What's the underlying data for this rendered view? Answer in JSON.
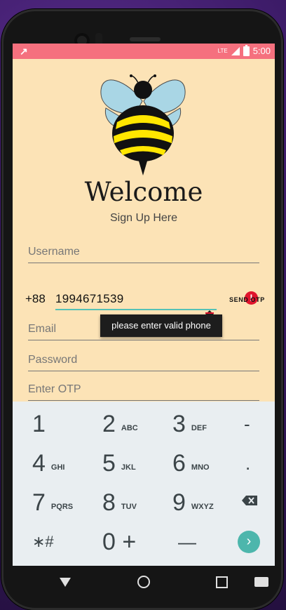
{
  "status_bar": {
    "time": "5:00",
    "network": "LTE",
    "left_icon": "notification-icon",
    "color": "#f5707e"
  },
  "header": {
    "logo": "bee-logo",
    "title": "Welcome",
    "subtitle": "Sign Up Here"
  },
  "form": {
    "username_placeholder": "Username",
    "country_code": "+88",
    "phone_value": "1994671539",
    "send_otp_label": "SEND OTP",
    "phone_error": "please enter valid phone",
    "email_placeholder": "Email",
    "password_placeholder": "Password",
    "otp_placeholder": "Enter OTP"
  },
  "keyboard": {
    "keys": [
      {
        "main": "1",
        "sub": ""
      },
      {
        "main": "2",
        "sub": "ABC"
      },
      {
        "main": "3",
        "sub": "DEF"
      },
      {
        "main": "-",
        "sub": ""
      },
      {
        "main": "4",
        "sub": "GHI"
      },
      {
        "main": "5",
        "sub": "JKL"
      },
      {
        "main": "6",
        "sub": "MNO"
      },
      {
        "main": ".",
        "sub": ""
      },
      {
        "main": "7",
        "sub": "PQRS"
      },
      {
        "main": "8",
        "sub": "TUV"
      },
      {
        "main": "9",
        "sub": "WXYZ"
      },
      {
        "main": "backspace",
        "sub": ""
      },
      {
        "main": "*#",
        "sub": ""
      },
      {
        "main": "0 +",
        "sub": ""
      },
      {
        "main": "_",
        "sub": ""
      },
      {
        "main": "next",
        "sub": ""
      }
    ]
  },
  "nav_bar": {
    "back": "back-icon",
    "home": "home-icon",
    "recents": "recents-icon",
    "keyboard": "keyboard-icon"
  },
  "colors": {
    "background": "#fce3b6",
    "accent": "#55c2b6",
    "error": "#e0142d",
    "keyboard_bg": "#e9eef1"
  }
}
